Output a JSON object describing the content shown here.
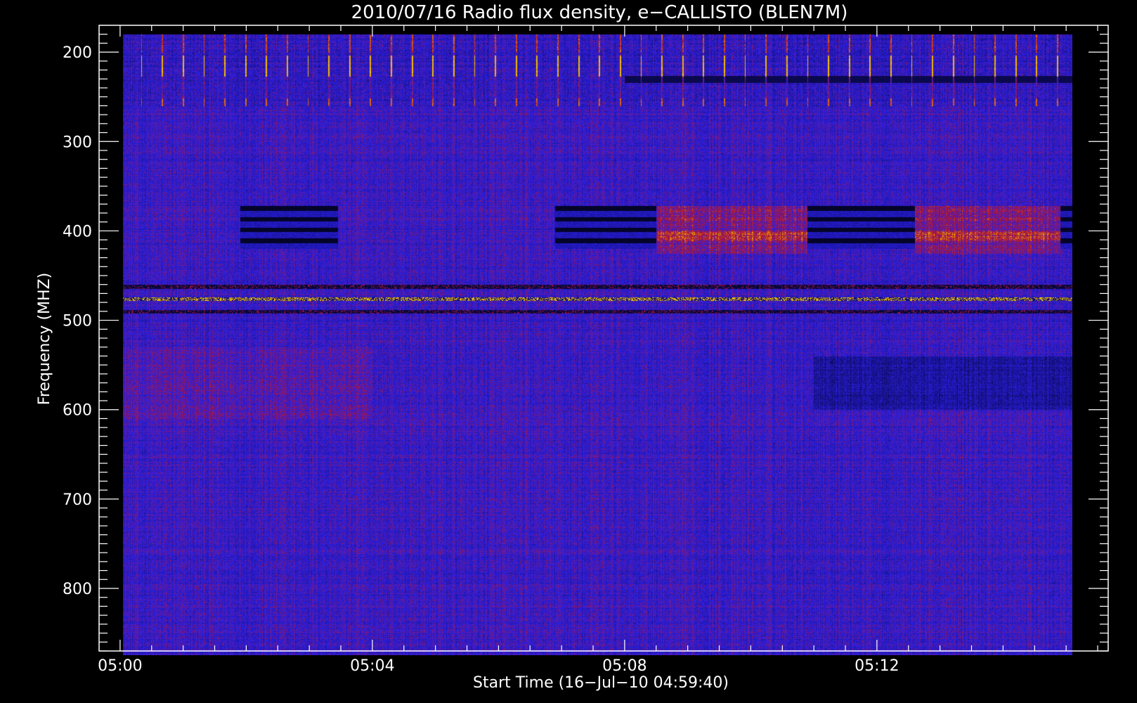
{
  "chart_data": {
    "type": "heatmap",
    "title": "2010/07/16  Radio flux density, e−CALLISTO (BLEN7M)",
    "xlabel": "Start Time (16−Jul−10 04:59:40)",
    "ylabel": "Frequency (MHZ)",
    "x_ticks": [
      {
        "label": "05:00",
        "minutes": 0
      },
      {
        "label": "05:04",
        "minutes": 4
      },
      {
        "label": "05:08",
        "minutes": 8
      },
      {
        "label": "05:12",
        "minutes": 12
      }
    ],
    "y_ticks": [
      {
        "label": "200",
        "value": 200
      },
      {
        "label": "300",
        "value": 300
      },
      {
        "label": "400",
        "value": 400
      },
      {
        "label": "500",
        "value": 500
      },
      {
        "label": "600",
        "value": 600
      },
      {
        "label": "700",
        "value": 700
      },
      {
        "label": "800",
        "value": 800
      }
    ],
    "xlim_minutes": [
      -0.333,
      15.667
    ],
    "ylim_mhz": [
      170,
      870
    ],
    "data_extent": {
      "t_start": 0.05,
      "t_end": 15.1,
      "f_min": 180,
      "f_max": 875
    },
    "y_inverted": true,
    "grid": false,
    "colors": {
      "background": "#000000",
      "frame": "#ffffff",
      "base": "#2a1fe6",
      "low": "#05052a",
      "mid": "#c02020",
      "high": "#ffd200"
    },
    "features": [
      {
        "name": "blocks",
        "freq_range": [
          372,
          420
        ],
        "time_ranges": [
          [
            1.9,
            3.45
          ],
          [
            6.9,
            8.5
          ],
          [
            10.9,
            12.6
          ],
          [
            14.9,
            15.1
          ]
        ]
      },
      {
        "name": "warm-blocks",
        "freq_range": [
          372,
          425
        ],
        "time_ranges": [
          [
            8.5,
            10.9
          ],
          [
            12.6,
            14.9
          ]
        ]
      },
      {
        "name": "lines",
        "freqs": [
          462,
          476,
          490
        ]
      },
      {
        "name": "bursts",
        "freq_range": [
          180,
          260
        ],
        "period_minutes": 0.33
      }
    ]
  }
}
